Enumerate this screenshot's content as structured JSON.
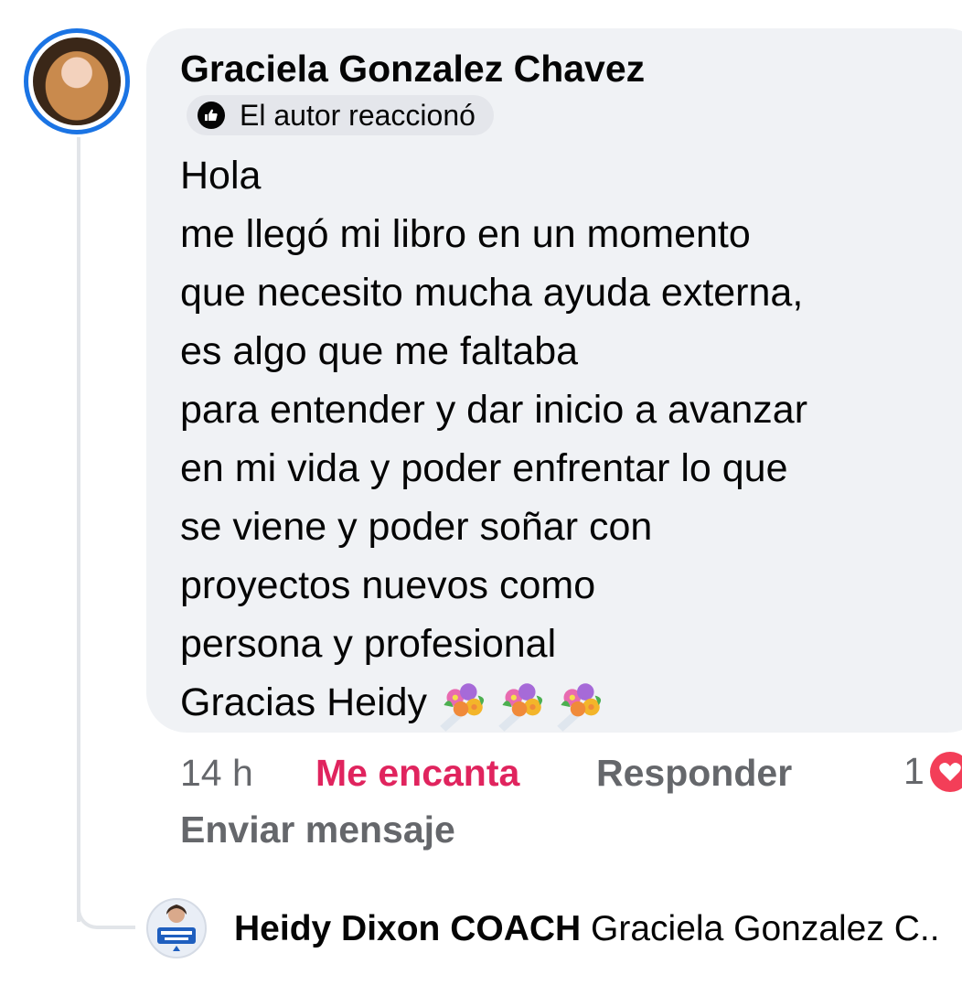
{
  "comment": {
    "author": "Graciela Gonzalez Chavez",
    "author_reaction": "El autor reaccionó",
    "lines": [
      "Hola",
      "me llegó mi libro en un momento",
      "que necesito mucha ayuda externa,",
      "es algo que me faltaba",
      "para entender y dar inicio a avanzar",
      "en mi vida y poder enfrentar lo que",
      "se viene y poder soñar  con",
      "proyectos nuevos como",
      "persona y profesional",
      "Gracias Heidy"
    ],
    "trailing_emoji": "bouquet-icon x3",
    "time": "14 h",
    "reaction_label": "Me encanta",
    "reply_label": "Responder",
    "reaction_count": "1",
    "send_message_label": "Enviar mensaje"
  },
  "reply": {
    "author": "Heidy Dixon COACH",
    "preview": "Graciela Gonzalez C.."
  },
  "colors": {
    "bubble": "#f0f2f5",
    "avatar_ring": "#1b74e4",
    "love": "#e0245e",
    "heart": "#f33e58",
    "muted": "#65676b"
  }
}
